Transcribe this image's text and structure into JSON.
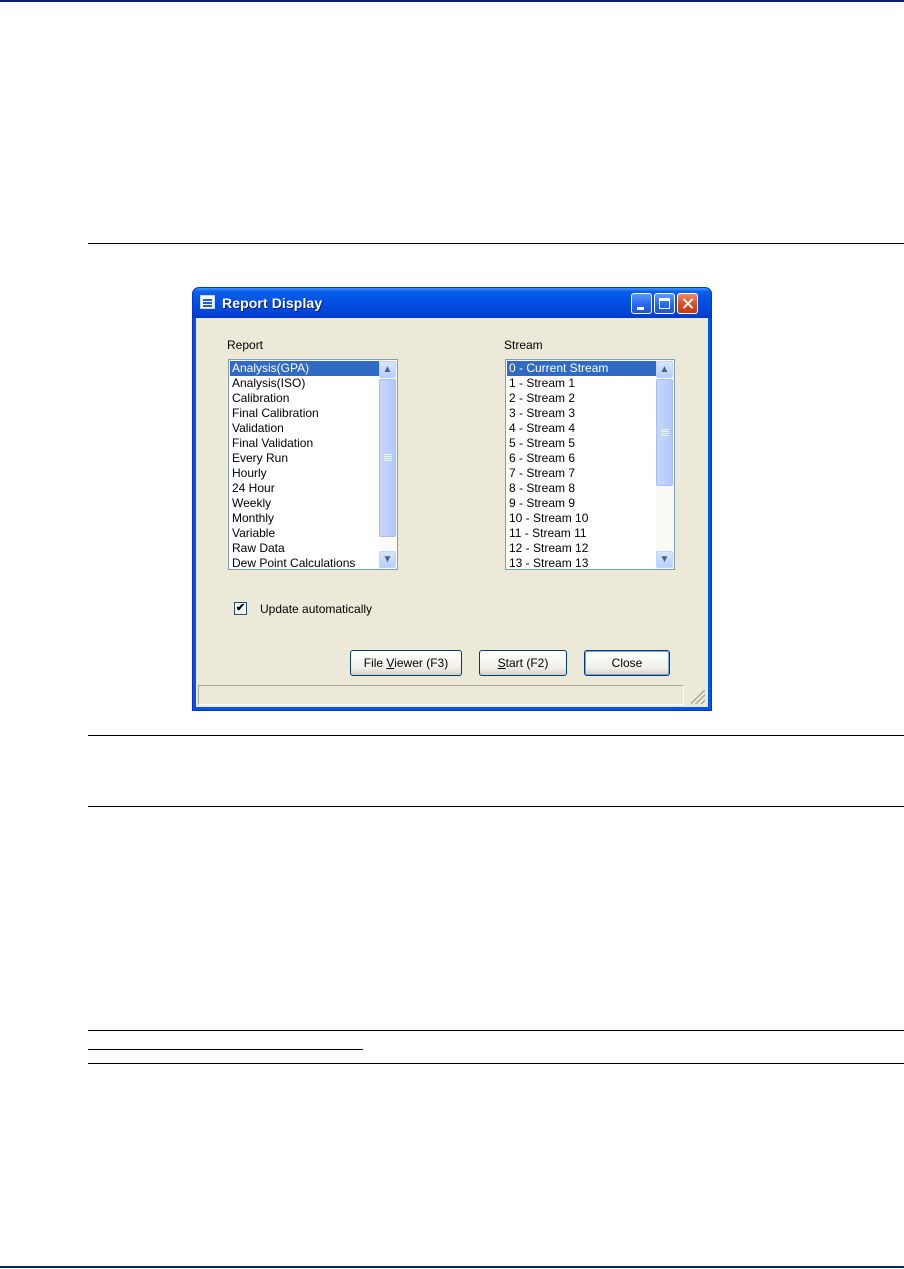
{
  "window": {
    "title": "Report Display"
  },
  "report": {
    "label": "Report",
    "items": [
      "Analysis(GPA)",
      "Analysis(ISO)",
      "Calibration",
      "Final Calibration",
      "Validation",
      "Final Validation",
      "Every Run",
      "Hourly",
      "24 Hour",
      "Weekly",
      "Monthly",
      "Variable",
      "Raw Data",
      "Dew Point Calculations"
    ],
    "selected": "Analysis(GPA)"
  },
  "stream": {
    "label": "Stream",
    "items": [
      "0 - Current Stream",
      "1 - Stream 1",
      "2 - Stream 2",
      "3 - Stream 3",
      "4 - Stream 4",
      "5 - Stream 5",
      "6 - Stream 6",
      "7 - Stream 7",
      "8 - Stream 8",
      "9 - Stream 9",
      "10 - Stream 10",
      "11 - Stream 11",
      "12 - Stream 12",
      "13 - Stream 13"
    ],
    "selected": "0 - Current Stream"
  },
  "update": {
    "label": "Update automatically",
    "checked": true
  },
  "buttons": {
    "file_viewer": "File Viewer (F3)",
    "start": "Start (F2)",
    "close": "Close"
  },
  "icons": {
    "window": "window-list-icon",
    "scroll_up": "chevron-up-icon",
    "scroll_down": "chevron-down-icon"
  },
  "colors": {
    "title_bar": "#0055e5",
    "selection": "#316ac5",
    "dialog_bg": "#ece9d8",
    "close_button": "#dd4a1f"
  }
}
